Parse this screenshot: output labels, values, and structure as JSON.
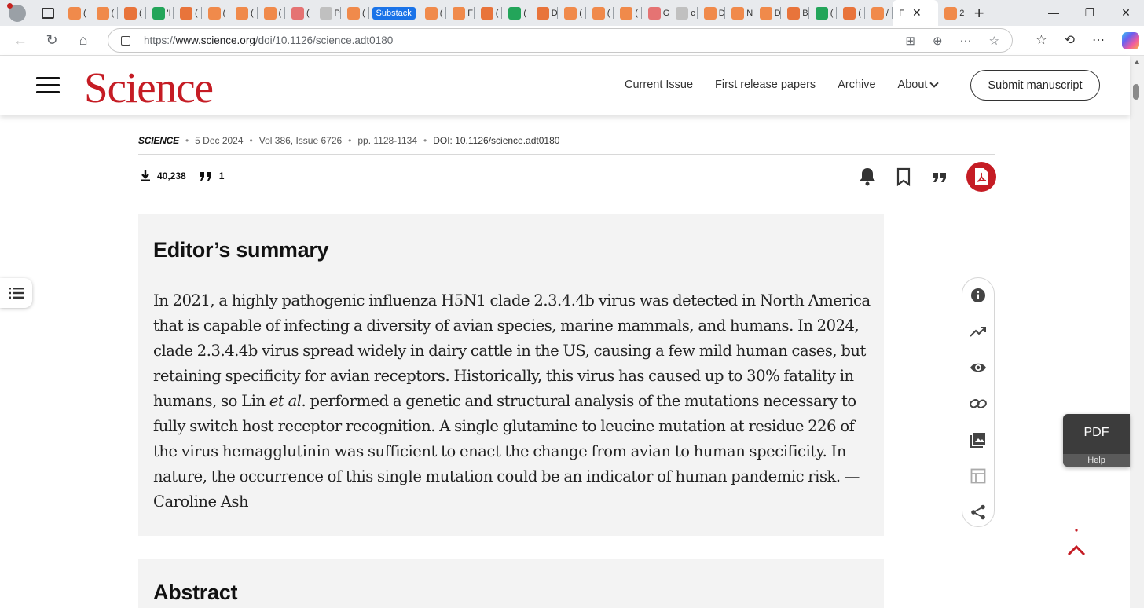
{
  "browser": {
    "tab_labels": [
      "(",
      "(",
      "(",
      "'I",
      "(",
      "(",
      "(",
      "(",
      "(",
      "P",
      "(",
      "(",
      "F",
      "(",
      "(",
      "D",
      "(",
      "(",
      "(",
      "G",
      "c",
      "D",
      "N",
      "D",
      "B",
      "(",
      "(",
      "/",
      "F",
      "2"
    ],
    "substack_tab": "Substack",
    "url_prefix": "https://",
    "url_host": "www.science.org",
    "url_path": "/doi/10.1126/science.adt0180"
  },
  "header": {
    "logo": "Science",
    "nav": [
      "Current Issue",
      "First release papers",
      "Archive",
      "About"
    ],
    "submit_label": "Submit manuscript"
  },
  "article": {
    "journal": "SCIENCE",
    "date": "5 Dec 2024",
    "volume": "Vol 386, Issue 6726",
    "pages": "pp. 1128-1134",
    "doi": "DOI: 10.1126/science.adt0180",
    "downloads": "40,238",
    "citations": "1"
  },
  "summary": {
    "title": "Editor’s summary",
    "text_before": "In 2021, a highly pathogenic influenza H5N1 clade 2.3.4.4b virus was detected in North America that is capable of infecting a diversity of avian species, marine mammals, and humans. In 2024, clade 2.3.4.4b virus spread widely in dairy cattle in the US, causing a few mild human cases, but retaining specificity for avian receptors. Historically, this virus has caused up to 30% fatality in humans, so Lin ",
    "text_italic": "et al",
    "text_after": ". performed a genetic and structural analysis of the mutations necessary to fully switch host receptor recognition. A single glutamine to leucine mutation at residue 226 of the virus hemagglutinin was sufficient to enact the change from avian to human specificity. In nature, the occurrence of this single mutation could be an indicator of human pandemic risk. —Caroline Ash"
  },
  "abstract": {
    "title": "Abstract"
  },
  "side_rail_icons": [
    "info-icon",
    "trending-icon",
    "eye-icon",
    "link-icon",
    "image-icon",
    "table-icon",
    "share-icon"
  ],
  "pdf_widget": {
    "label": "PDF",
    "help": "Help"
  },
  "colors": {
    "brand_red": "#c51c24",
    "summary_bg": "#f3f3f3",
    "substack_blue": "#1a73e8"
  }
}
